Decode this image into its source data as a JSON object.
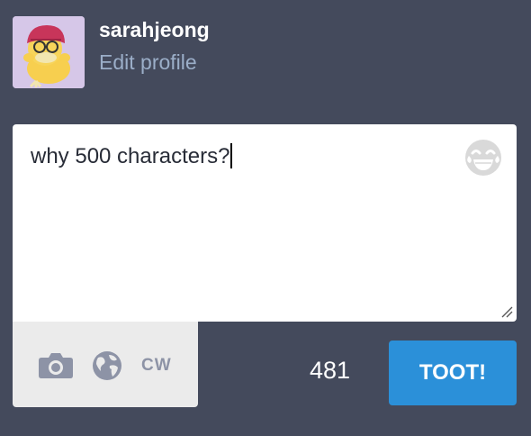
{
  "profile": {
    "username": "sarahjeong",
    "edit_label": "Edit profile",
    "avatar_icon": "psyduck-avatar"
  },
  "compose": {
    "text": "why 500 characters?",
    "emoji_icon": "laughing-emoji-icon"
  },
  "tools": {
    "camera_icon": "camera-icon",
    "globe_icon": "globe-icon",
    "cw_label": "CW"
  },
  "counter": "481",
  "toot_label": "TOOT!",
  "colors": {
    "background": "#444a5c",
    "accent": "#2b90d9",
    "link": "#9baec8",
    "tools_background": "#ebebeb"
  }
}
